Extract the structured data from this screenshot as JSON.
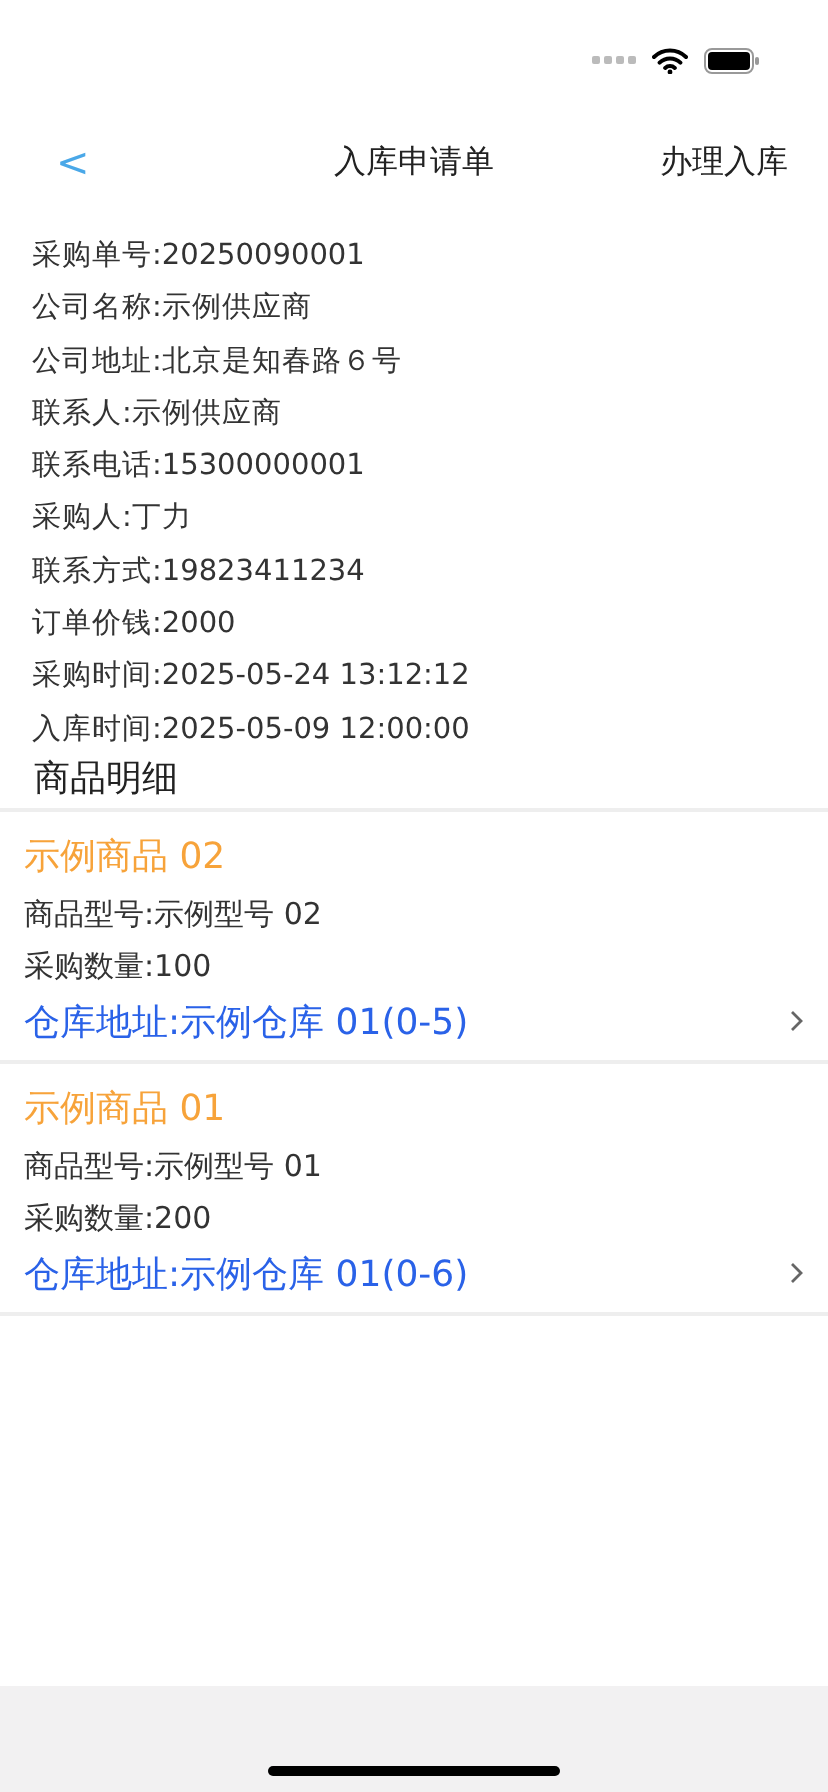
{
  "nav": {
    "back": "<",
    "title": "入库申请单",
    "action": "办理入库"
  },
  "info": [
    "采购单号:20250090001",
    "公司名称:示例供应商",
    "公司地址:北京是知春路６号",
    "联系人:示例供应商",
    "联系电话:15300000001",
    "采购人:丁力",
    "联系方式:19823411234",
    "订单价钱:2000",
    "采购时间:2025-05-24 13:12:12",
    "入库时间:2025-05-09 12:00:00"
  ],
  "section_title": "商品明细",
  "products": [
    {
      "name": "示例商品 02",
      "model": "商品型号:示例型号 02",
      "quantity": "采购数量:100",
      "warehouse": "仓库地址:示例仓库 01(0-5)"
    },
    {
      "name": "示例商品 01",
      "model": "商品型号:示例型号 01",
      "quantity": "采购数量:200",
      "warehouse": "仓库地址:示例仓库 01(0-6)"
    }
  ]
}
